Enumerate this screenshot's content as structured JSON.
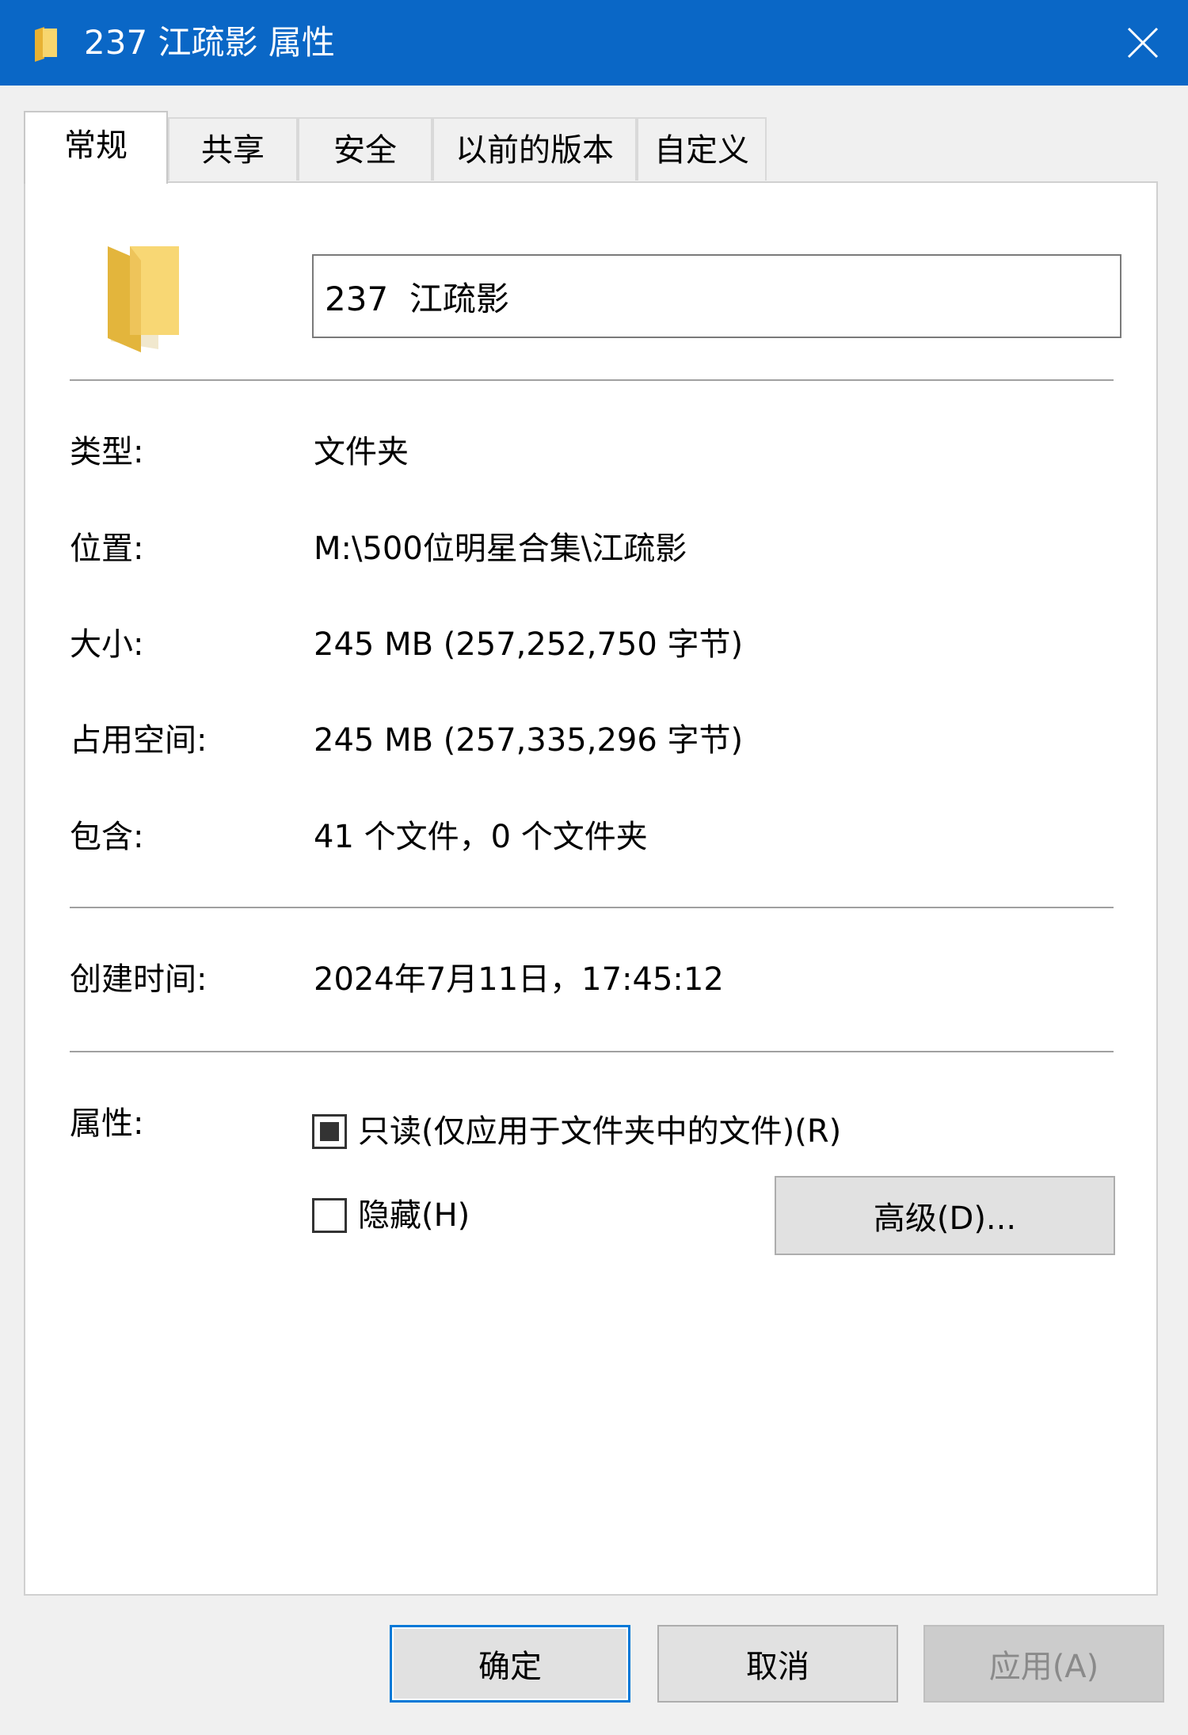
{
  "window": {
    "title": "237 江疏影 属性"
  },
  "tabs": [
    {
      "label": "常规"
    },
    {
      "label": "共享"
    },
    {
      "label": "安全"
    },
    {
      "label": "以前的版本"
    },
    {
      "label": "自定义"
    }
  ],
  "general": {
    "name_value": "237  江疏影",
    "type_label": "类型:",
    "type_value": "文件夹",
    "location_label": "位置:",
    "location_value": "M:\\500位明星合集\\江疏影",
    "size_label": "大小:",
    "size_value": "245 MB (257,252,750 字节)",
    "size_on_disk_label": "占用空间:",
    "size_on_disk_value": "245 MB (257,335,296 字节)",
    "contains_label": "包含:",
    "contains_value": "41 个文件，0 个文件夹",
    "created_label": "创建时间:",
    "created_value": "2024年7月11日，17:45:12",
    "attributes_label": "属性:",
    "readonly_label": "只读(仅应用于文件夹中的文件)(R)",
    "hidden_label": "隐藏(H)",
    "advanced_button": "高级(D)..."
  },
  "footer": {
    "ok_button": "确定",
    "cancel_button": "取消",
    "apply_button": "应用(A)"
  },
  "colors": {
    "titlebar": "#0a67c6",
    "focus_border": "#0078d7",
    "folder_yellow": "#f5c84c"
  }
}
